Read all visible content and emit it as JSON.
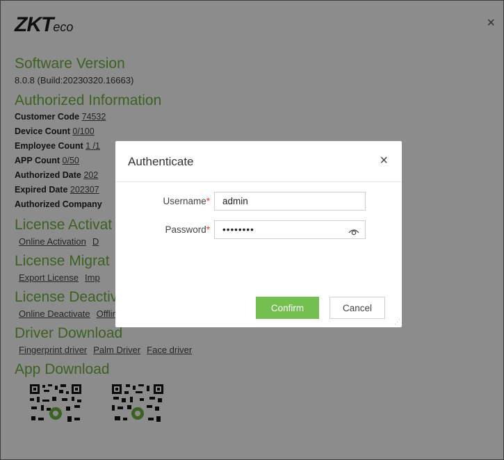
{
  "window": {
    "logo_main": "ZKT",
    "logo_suffix": "eco",
    "close_glyph": "×"
  },
  "sections": {
    "software_version": {
      "title": "Software Version",
      "value": "8.0.8 (Build:20230320.16663)"
    },
    "authorized_information": {
      "title": "Authorized Information",
      "rows": [
        {
          "label": "Customer Code",
          "value": "74532"
        },
        {
          "label": "Device Count",
          "value": "0/100"
        },
        {
          "label": "Employee Count",
          "value": "1 /1"
        },
        {
          "label": "APP Count",
          "value": "0/50"
        },
        {
          "label": "Authorized Date",
          "value": "202"
        },
        {
          "label": "Expired Date",
          "value": "202307"
        },
        {
          "label": "Authorized Company",
          "value": ""
        }
      ]
    },
    "license_activation": {
      "title": "License Activat",
      "links": [
        "Online Activation",
        "D"
      ]
    },
    "license_migration": {
      "title": "License Migrat",
      "links": [
        "Export License",
        "Imp"
      ]
    },
    "license_deactivation": {
      "title": "License Deactivate",
      "links": [
        "Online Deactivate",
        "Offline Deactivate"
      ]
    },
    "driver_download": {
      "title": "Driver Download",
      "links": [
        "Fingerprint driver",
        "Palm Driver",
        "Face driver"
      ]
    },
    "app_download": {
      "title": "App Download"
    }
  },
  "dialog": {
    "title": "Authenticate",
    "close_glyph": "×",
    "username_label": "Username",
    "password_label": "Password",
    "required_mark": "*",
    "username_value": "admin",
    "password_value": "••••••••",
    "confirm_label": "Confirm",
    "cancel_label": "Cancel"
  },
  "colors": {
    "accent_green": "#6cb23c",
    "confirm_green": "#73c051",
    "required_red": "#e33333"
  },
  "icons": {
    "window_close": "close-icon",
    "dialog_close": "close-icon",
    "password_toggle": "eye-icon",
    "qr": "qr-code-icon"
  }
}
